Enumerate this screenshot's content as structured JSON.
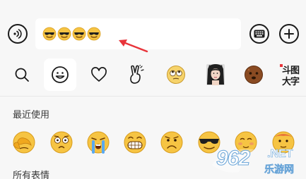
{
  "input_bar": {
    "voice_icon": "voice-input-icon",
    "field_content": [
      "sunglasses-emoji",
      "sunglasses-emoji",
      "sunglasses-emoji",
      "sunglasses-emoji"
    ],
    "emoji_keyboard_icon": "emoji-keyboard-icon",
    "plus_icon": "plus-icon"
  },
  "tabs": [
    {
      "name": "search",
      "icon": "search-icon"
    },
    {
      "name": "emoji",
      "icon": "smiley-face-icon",
      "active": true
    },
    {
      "name": "favorites",
      "icon": "heart-icon"
    },
    {
      "name": "gestures",
      "icon": "victory-hand-icon"
    },
    {
      "name": "sticker-pack-face",
      "icon": "rolling-eyes-sticker-icon"
    },
    {
      "name": "sticker-pack-photo",
      "icon": "girl-photo-sticker-icon"
    },
    {
      "name": "sticker-pack-poop",
      "icon": "brown-face-sticker-icon"
    },
    {
      "name": "doutu",
      "label": "斗图大字"
    }
  ],
  "sections": {
    "recent_title": "最近使用",
    "all_title": "所有表情"
  },
  "recent_emojis": [
    "facepalm-emoji",
    "shocked-emoji",
    "crying-emoji",
    "grimace-emoji",
    "frown-emoji",
    "sunglasses-emoji",
    "blush-emoji",
    "shy-emoji"
  ],
  "watermark": {
    "number": "962",
    "domain": ".NET",
    "site": "乐游网"
  },
  "colors": {
    "background": "#f7f7f7",
    "field_bg": "#ffffff",
    "emoji_yellow": "#f6c443",
    "emoji_outline": "#d79b1c",
    "arrow_red": "#e8343a",
    "text": "#3a3a3a"
  }
}
